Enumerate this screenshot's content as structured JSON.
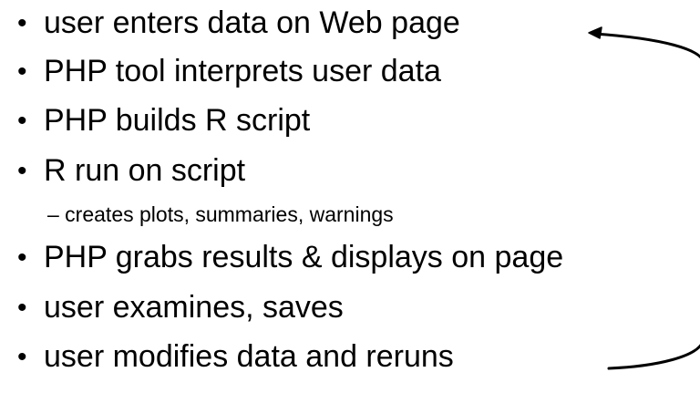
{
  "slide": {
    "items": [
      {
        "text": "user enters data on Web page"
      },
      {
        "text": "PHP tool interprets user data"
      },
      {
        "text": "PHP builds R script"
      },
      {
        "text": "R run on script"
      },
      {
        "text": "– creates plots, summaries, warnings"
      },
      {
        "text": "PHP grabs results & displays on page"
      },
      {
        "text": "user examines, saves"
      },
      {
        "text": "user modifies data and reruns"
      }
    ],
    "bullet_glyph": "•",
    "arrow_color": "#000000"
  }
}
